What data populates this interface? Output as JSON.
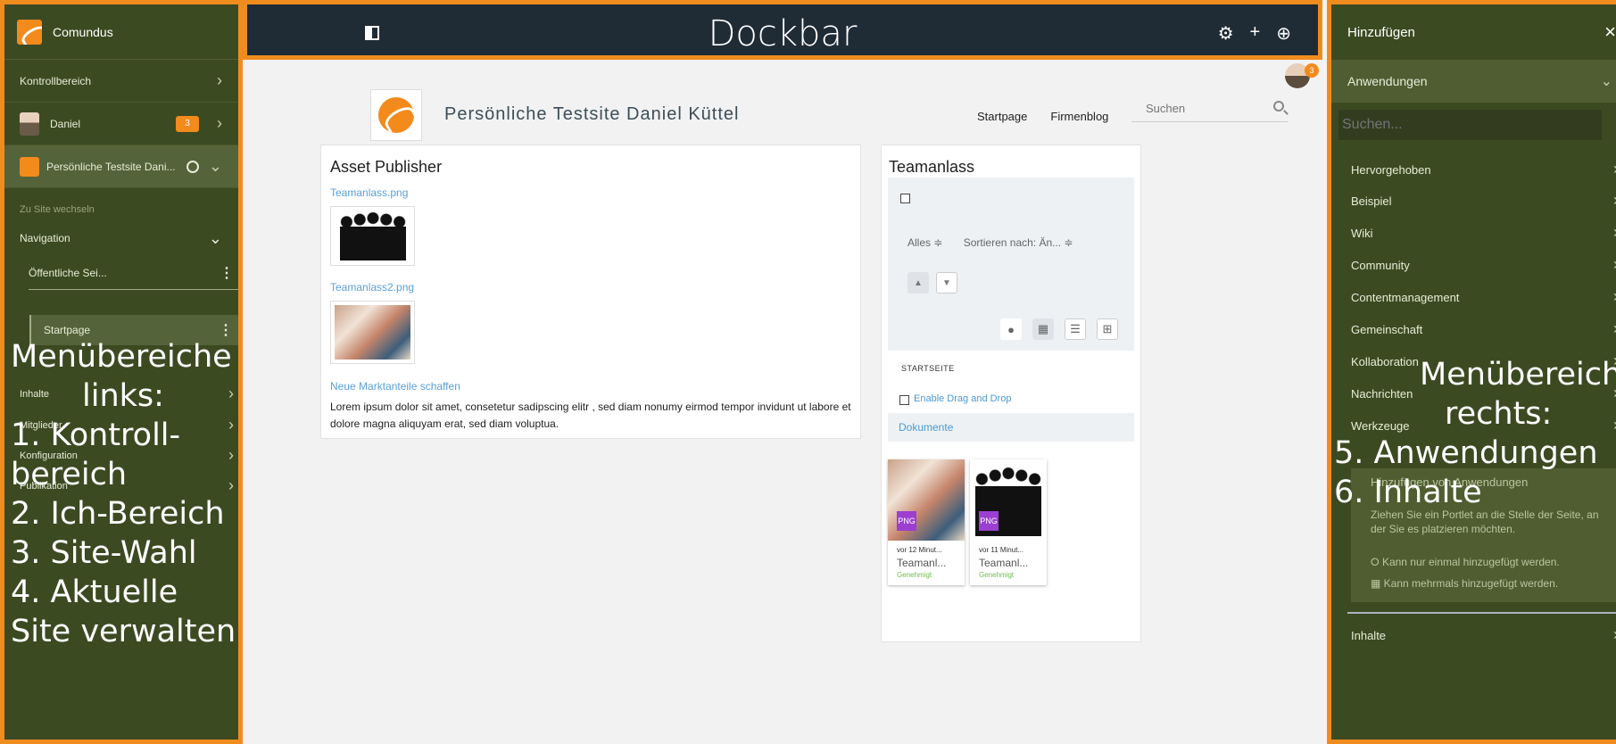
{
  "left": {
    "brand": "Comundus",
    "kontroll": "Kontrollbereich",
    "user": "Daniel",
    "user_badge": "3",
    "site": "Persönliche Testsite Dani...",
    "switch": "Zu Site wechseln",
    "navigation": "Navigation",
    "public_pages": "Öffentliche Sei...",
    "startpage": "Startpage",
    "menu": [
      "Inhalte",
      "Mitglieder",
      "Konfiguration",
      "Publikation"
    ]
  },
  "overlay_left": {
    "line1": "Menübereiche",
    "line2": "links:",
    "line3": "1. Kontroll-",
    "line4": "bereich",
    "line5": "2. Ich-Bereich",
    "line6": "3. Site-Wahl",
    "line7": "4. Aktuelle",
    "line8": "Site verwalten"
  },
  "dockbar": {
    "title": "Dockbar",
    "icons": [
      "gear-icon",
      "plus-icon",
      "globe-icon"
    ]
  },
  "site": {
    "title": "Persönliche Testsite Daniel Küttel",
    "nav": [
      "Startpage",
      "Firmenblog"
    ],
    "search_placeholder": "Suchen",
    "notif_badge": "3"
  },
  "asset_publisher": {
    "title": "Asset Publisher",
    "link1": "Teamanlass.png",
    "link2": "Teamanlass2.png",
    "article_title": "Neue Marktanteile schaffen",
    "article_body": "Lorem ipsum dolor sit amet, consetetur sadipscing elitr , sed diam nonumy eirmod tempor invidunt ut labore et dolore magna aliquyam erat, sed diam voluptua."
  },
  "team": {
    "title": "Teamanlass",
    "filter_all": "Alles ≑",
    "sort": "Sortieren nach: Än... ≑",
    "startseite": "STARTSEITE",
    "drag_drop": "Enable Drag and Drop",
    "documents": "Dokumente",
    "cards": [
      {
        "tag": "PNG",
        "meta": "vor 12 Minut...",
        "name": "Teamanl...",
        "status": "Genehmigt"
      },
      {
        "tag": "PNG",
        "meta": "vor 11 Minut...",
        "name": "Teamanl...",
        "status": "Genehmigt"
      }
    ]
  },
  "right": {
    "title": "Hinzufügen",
    "close": "×",
    "section": "Anwendungen",
    "search_placeholder": "Suchen...",
    "items": [
      "Hervorgehoben",
      "Beispiel",
      "Wiki",
      "Community",
      "Contentmanagement",
      "Gemeinschaft",
      "Kollaboration",
      "Nachrichten",
      "Werkzeuge"
    ],
    "help_title": "Hinzufügen von Anwendungen",
    "help_desc": "Ziehen Sie ein Portlet an die Stelle der Seite, an der Sie es platzieren möchten.",
    "help_once": "Kann nur einmal hinzugefügt werden.",
    "help_multi": "Kann mehrmals hinzugefügt werden.",
    "inhalte": "Inhalte"
  },
  "overlay_right": {
    "line1": "Menübereiche",
    "line2": "rechts:",
    "line3": "5. Anwendungen",
    "line4": "6. Inhalte"
  }
}
